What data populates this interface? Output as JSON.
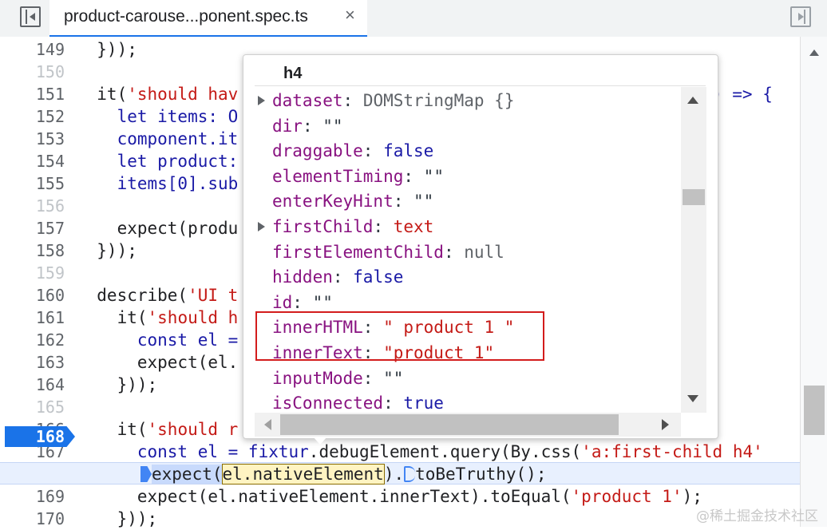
{
  "tab": {
    "title": "product-carouse...ponent.spec.ts",
    "close": "×"
  },
  "editor": {
    "lines": [
      {
        "num": "149",
        "dim": false
      },
      {
        "num": "150",
        "dim": true
      },
      {
        "num": "151",
        "dim": false
      },
      {
        "num": "152",
        "dim": false
      },
      {
        "num": "153",
        "dim": false
      },
      {
        "num": "154",
        "dim": false
      },
      {
        "num": "155",
        "dim": false
      },
      {
        "num": "156",
        "dim": true
      },
      {
        "num": "157",
        "dim": false
      },
      {
        "num": "158",
        "dim": false
      },
      {
        "num": "159",
        "dim": true
      },
      {
        "num": "160",
        "dim": false
      },
      {
        "num": "161",
        "dim": false
      },
      {
        "num": "162",
        "dim": false
      },
      {
        "num": "163",
        "dim": false
      },
      {
        "num": "164",
        "dim": false
      },
      {
        "num": "165",
        "dim": true
      },
      {
        "num": "166",
        "dim": false
      },
      {
        "num": "167",
        "dim": false
      },
      {
        "num": "168",
        "dim": false
      },
      {
        "num": "169",
        "dim": false
      },
      {
        "num": "170",
        "dim": false
      }
    ],
    "code": {
      "l149": "  }));",
      "l151a": "  it(",
      "l151s": "'should hav",
      "l151e": ") => {",
      "l152": "    let items: O",
      "l153": "    component.it",
      "l154": "    let product:",
      "l155": "    items[0].sub",
      "l157": "    expect(produ",
      "l158": "  }));",
      "l160a": "  describe(",
      "l160s": "'UI t",
      "l161a": "    it(",
      "l161s": "'should h",
      "l162": "      const el =",
      "l163": "      expect(el.",
      "l164": "    }));",
      "l166a": "    it(",
      "l166s": "'should r",
      "l166e": "{",
      "l167a": "      const el = fixtur",
      "l167b": ".debugElement.query(By.css(",
      "l167s": "'a:first-child h4'",
      "l168a": "expect(",
      "l168b": "el.nativeElement",
      "l168c": ").",
      "l168d": "toBeTruthy();",
      "l169a": "      expect(el.nativeElement.innerText).toEqual(",
      "l169s": "'product 1'",
      "l169e": ");",
      "l170": "    }));"
    },
    "paused_line": "168"
  },
  "popover": {
    "header": "h4",
    "properties": [
      {
        "key": "dataset",
        "sep": ": ",
        "value": "DOMStringMap {}",
        "kind": "obj",
        "expandable": true
      },
      {
        "key": "dir",
        "sep": ": ",
        "value": "\"\"",
        "kind": "plain",
        "expandable": false
      },
      {
        "key": "draggable",
        "sep": ": ",
        "value": "false",
        "kind": "bool",
        "expandable": false
      },
      {
        "key": "elementTiming",
        "sep": ": ",
        "value": "\"\"",
        "kind": "plain",
        "expandable": false
      },
      {
        "key": "enterKeyHint",
        "sep": ": ",
        "value": "\"\"",
        "kind": "plain",
        "expandable": false
      },
      {
        "key": "firstChild",
        "sep": ": ",
        "value": "text",
        "kind": "obj2",
        "expandable": true
      },
      {
        "key": "firstElementChild",
        "sep": ": ",
        "value": "null",
        "kind": "null",
        "expandable": false
      },
      {
        "key": "hidden",
        "sep": ": ",
        "value": "false",
        "kind": "bool",
        "expandable": false
      },
      {
        "key": "id",
        "sep": ": ",
        "value": "\"\"",
        "kind": "plain",
        "expandable": false
      },
      {
        "key": "innerHTML",
        "sep": ": ",
        "value": "\" product 1 \"",
        "kind": "str",
        "expandable": false
      },
      {
        "key": "innerText",
        "sep": ": ",
        "value": "\"product 1\"",
        "kind": "str",
        "expandable": false
      },
      {
        "key": "inputMode",
        "sep": ": ",
        "value": "\"\"",
        "kind": "plain",
        "expandable": false
      },
      {
        "key": "isConnected",
        "sep": ": ",
        "value": "true",
        "kind": "bool",
        "expandable": false
      }
    ]
  },
  "watermark": "@稀土掘金技术社区",
  "colors": {
    "accent": "#1a73e8",
    "highlight_box": "#d31c1c",
    "string": "#c41a16",
    "property_key": "#881280",
    "keyword_value": "#1a1aa6"
  }
}
